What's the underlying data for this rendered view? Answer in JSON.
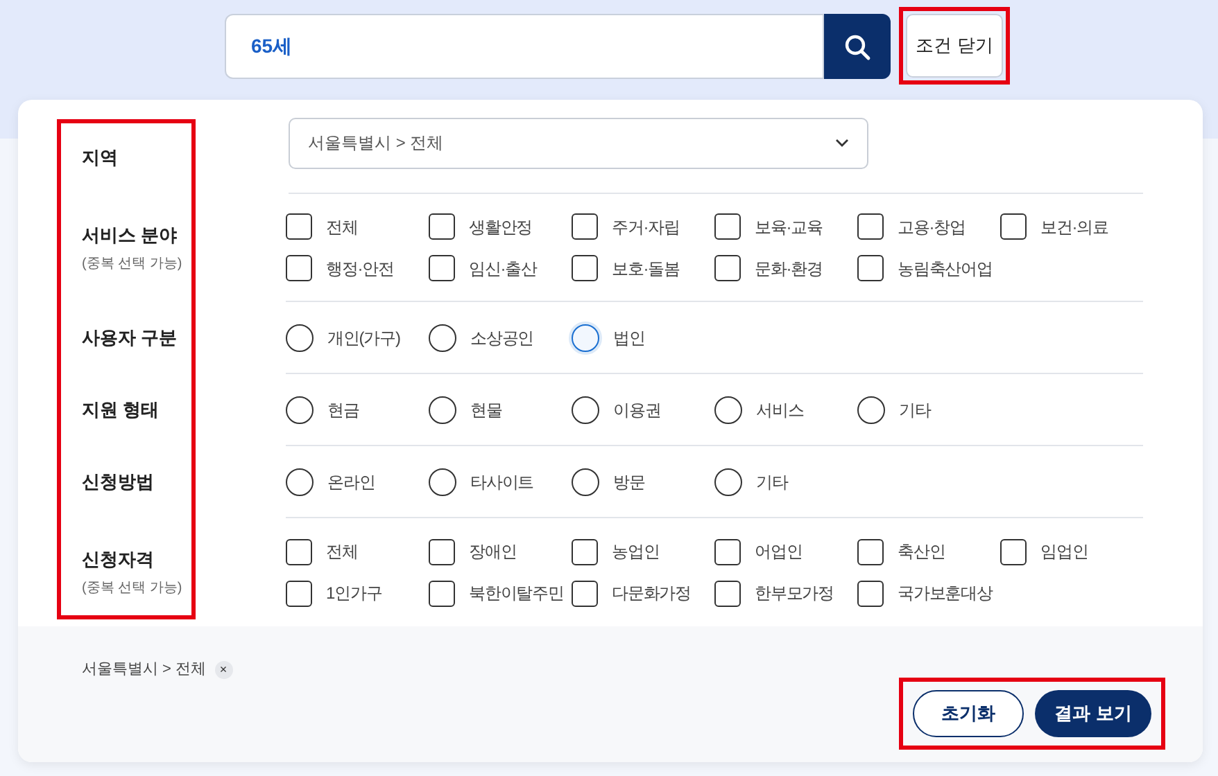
{
  "search": {
    "value": "65세"
  },
  "close_button": "조건 닫기",
  "filters": [
    {
      "label": "지역",
      "kind": "dropdown",
      "value": "서울특별시 > 전체"
    },
    {
      "label": "서비스 분야",
      "note": "(중복 선택 가능)",
      "kind": "checkbox",
      "options": [
        {
          "label": "전체",
          "checked": false
        },
        {
          "label": "생활안정",
          "checked": false
        },
        {
          "label": "주거·자립",
          "checked": false
        },
        {
          "label": "보육·교육",
          "checked": false
        },
        {
          "label": "고용·창업",
          "checked": false
        },
        {
          "label": "보건·의료",
          "checked": false
        },
        {
          "label": "행정·안전",
          "checked": false
        },
        {
          "label": "임신·출산",
          "checked": false
        },
        {
          "label": "보호·돌봄",
          "checked": false
        },
        {
          "label": "문화·환경",
          "checked": false
        },
        {
          "label": "농림축산어업",
          "checked": false
        }
      ]
    },
    {
      "label": "사용자 구분",
      "kind": "radio",
      "options": [
        {
          "label": "개인(가구)",
          "selected": false
        },
        {
          "label": "소상공인",
          "selected": false
        },
        {
          "label": "법인",
          "selected": false,
          "focused": true
        }
      ]
    },
    {
      "label": "지원 형태",
      "kind": "radio",
      "options": [
        {
          "label": "현금",
          "selected": false
        },
        {
          "label": "현물",
          "selected": false
        },
        {
          "label": "이용권",
          "selected": false
        },
        {
          "label": "서비스",
          "selected": false
        },
        {
          "label": "기타",
          "selected": false
        }
      ]
    },
    {
      "label": "신청방법",
      "kind": "radio",
      "options": [
        {
          "label": "온라인",
          "selected": false
        },
        {
          "label": "타사이트",
          "selected": false
        },
        {
          "label": "방문",
          "selected": false
        },
        {
          "label": "기타",
          "selected": false
        }
      ]
    },
    {
      "label": "신청자격",
      "note": "(중복 선택 가능)",
      "kind": "checkbox",
      "options": [
        {
          "label": "전체",
          "checked": false
        },
        {
          "label": "장애인",
          "checked": false
        },
        {
          "label": "농업인",
          "checked": false
        },
        {
          "label": "어업인",
          "checked": false
        },
        {
          "label": "축산인",
          "checked": false
        },
        {
          "label": "임업인",
          "checked": false
        },
        {
          "label": "1인가구",
          "checked": false
        },
        {
          "label": "북한이탈주민",
          "checked": false
        },
        {
          "label": "다문화가정",
          "checked": false
        },
        {
          "label": "한부모가정",
          "checked": false
        },
        {
          "label": "국가보훈대상",
          "checked": false
        }
      ]
    }
  ],
  "selected_tags": [
    {
      "label": "서울특별시 > 전체",
      "remove": "×"
    }
  ],
  "buttons": {
    "reset": "초기화",
    "apply": "결과 보기"
  }
}
